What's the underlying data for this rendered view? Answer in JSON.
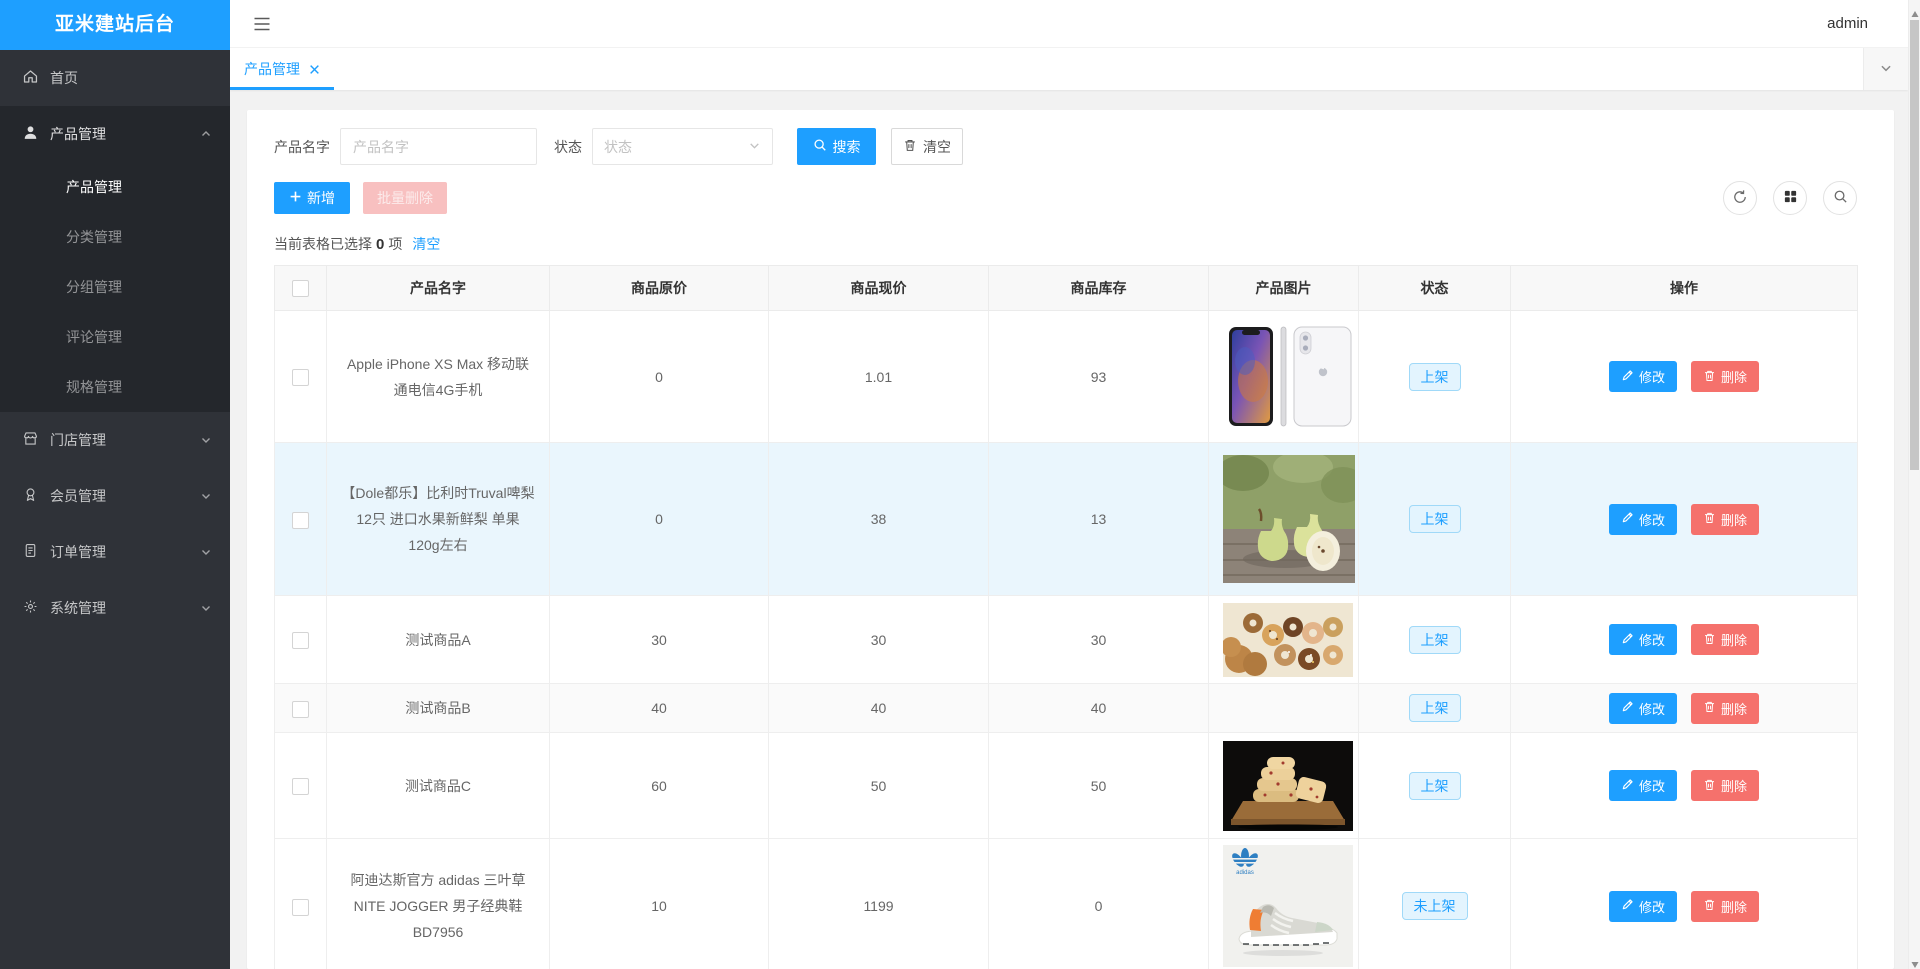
{
  "app": {
    "title": "亚米建站后台",
    "user": "admin"
  },
  "sidebar": {
    "items": [
      {
        "label": "首页",
        "icon": "home-icon"
      },
      {
        "label": "产品管理",
        "icon": "user-icon",
        "expanded": true,
        "children": [
          {
            "label": "产品管理",
            "active": true
          },
          {
            "label": "分类管理"
          },
          {
            "label": "分组管理"
          },
          {
            "label": "评论管理"
          },
          {
            "label": "规格管理"
          }
        ]
      },
      {
        "label": "门店管理",
        "icon": "store-icon"
      },
      {
        "label": "会员管理",
        "icon": "member-icon"
      },
      {
        "label": "订单管理",
        "icon": "order-icon"
      },
      {
        "label": "系统管理",
        "icon": "gear-icon"
      }
    ]
  },
  "tabbar": {
    "tabs": [
      {
        "label": "产品管理",
        "active": true
      }
    ]
  },
  "search": {
    "name_label": "产品名字",
    "name_placeholder": "产品名字",
    "status_label": "状态",
    "status_placeholder": "状态",
    "search_button": "搜索",
    "clear_button": "清空"
  },
  "toolbar": {
    "add_button": "新增",
    "batch_delete_button": "批量删除"
  },
  "selection": {
    "text_prefix": "当前表格已选择",
    "count": "0",
    "text_suffix": "项",
    "clear_link": "清空"
  },
  "table": {
    "headers": [
      "产品名字",
      "商品原价",
      "商品现价",
      "商品库存",
      "产品图片",
      "状态",
      "操作"
    ],
    "actions": {
      "edit": "修改",
      "delete": "删除"
    },
    "rows": [
      {
        "name": "Apple iPhone XS Max 移动联通电信4G手机",
        "original_price": "0",
        "price": "1.01",
        "stock": "93",
        "image": "iphone-xs-max",
        "status": "上架"
      },
      {
        "name": "【Dole都乐】比利时Truval啤梨12只 进口水果新鲜梨 单果120g左右",
        "original_price": "0",
        "price": "38",
        "stock": "13",
        "image": "dole-pears",
        "status": "上架"
      },
      {
        "name": "测试商品A",
        "original_price": "30",
        "price": "30",
        "stock": "30",
        "image": "donuts",
        "status": "上架"
      },
      {
        "name": "测试商品B",
        "original_price": "40",
        "price": "40",
        "stock": "40",
        "image": "",
        "status": "上架"
      },
      {
        "name": "测试商品C",
        "original_price": "60",
        "price": "50",
        "stock": "50",
        "image": "cookies",
        "status": "上架"
      },
      {
        "name": "阿迪达斯官方 adidas 三叶草 NITE JOGGER 男子经典鞋BD7956",
        "original_price": "10",
        "price": "1199",
        "stock": "0",
        "image": "adidas-sneaker",
        "status": "未上架"
      }
    ]
  },
  "colors": {
    "primary": "#1e9fff",
    "danger": "#f5716c",
    "danger_disabled": "#f8c0c0",
    "sidebar_bg": "#2f3238",
    "sidebar_submenu_bg": "#24272c",
    "status_badge_bg": "#e3f4fe",
    "status_badge_border": "#a0d9f8",
    "row_hover_bg": "#eaf6fd"
  }
}
